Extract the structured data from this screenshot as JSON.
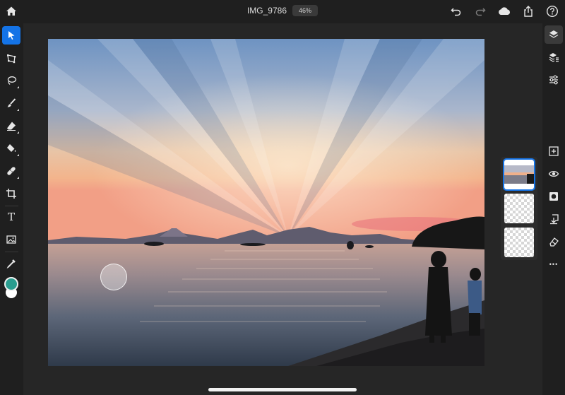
{
  "document": {
    "title": "IMG_9786",
    "zoom": "46%"
  },
  "top_bar": {
    "left_icons": [
      "home-icon"
    ],
    "right_icons": [
      "undo-icon",
      "redo-icon",
      "cloud-icon",
      "share-icon",
      "help-icon"
    ]
  },
  "left_toolbar": {
    "tools": [
      "select-tool-icon",
      "transform-tool-icon",
      "lasso-tool-icon",
      "brush-tool-icon",
      "eraser-tool-icon",
      "fill-tool-icon",
      "healing-tool-icon",
      "crop-tool-icon",
      "type-tool-icon",
      "place-image-icon",
      "eyedropper-icon"
    ],
    "active_tool": "select-tool-icon",
    "type_tool_glyph": "T",
    "colors": {
      "primary": "#2a9d8f",
      "secondary": "#ffffff"
    }
  },
  "right_panel": {
    "icons": [
      "layers-icon",
      "layer-properties-icon",
      "adjustments-icon",
      "add-layer-icon",
      "visibility-icon",
      "mask-icon",
      "merge-down-icon",
      "clear-layer-icon",
      "more-icon"
    ],
    "more_glyph": "•••"
  },
  "layers": [
    {
      "type": "photo",
      "selected": true
    },
    {
      "type": "empty",
      "selected": false
    },
    {
      "type": "empty",
      "selected": false
    }
  ],
  "colors": {
    "accent": "#1473e6",
    "background": "#1e1e1e",
    "toolbar": "#1f1f1f",
    "canvas": "#262626"
  }
}
